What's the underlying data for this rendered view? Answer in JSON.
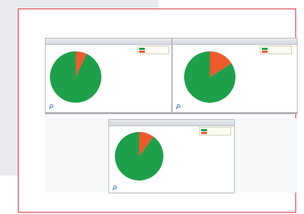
{
  "colors": {
    "frame": "#e0313a",
    "background_panel": "#e8e9ec",
    "pie_green": "#1ea04a",
    "pie_red": "#ee5a2c"
  },
  "panels": [
    {
      "title": "",
      "legend": [
        {
          "label": "",
          "color": "#1ea04a"
        },
        {
          "label": "",
          "color": "#ee5a2c"
        }
      ],
      "zoom_icon": "magnifier-icon",
      "slices": [
        0.93,
        0.07
      ]
    },
    {
      "title": "",
      "legend": [
        {
          "label": "",
          "color": "#1ea04a"
        },
        {
          "label": "",
          "color": "#ee5a2c"
        }
      ],
      "zoom_icon": "magnifier-icon",
      "slices": [
        0.84,
        0.16
      ]
    },
    {
      "title": "",
      "legend": [
        {
          "label": "",
          "color": "#1ea04a"
        },
        {
          "label": "",
          "color": "#ee5a2c"
        }
      ],
      "zoom_icon": "magnifier-icon",
      "slices": [
        0.9,
        0.1
      ]
    }
  ]
}
